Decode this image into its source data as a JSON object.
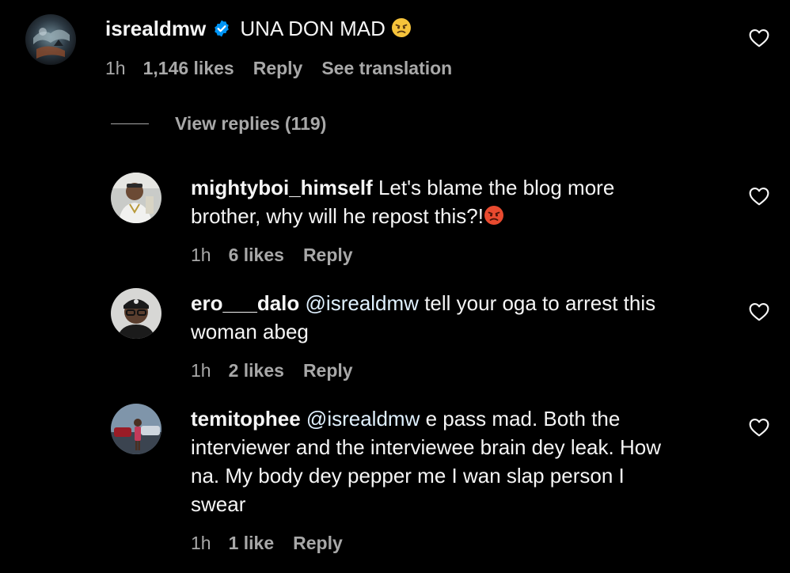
{
  "colors": {
    "background": "#000000",
    "text_primary": "#f5f5f5",
    "text_secondary": "#a8a8a8",
    "verified_badge": "#0095f6"
  },
  "main_comment": {
    "username": "isrealdmw",
    "verified": true,
    "text": "UNA DON MAD",
    "emoji": "angry-face",
    "time": "1h",
    "likes": "1,146 likes",
    "reply_label": "Reply",
    "translation_label": "See translation",
    "view_replies_label": "View replies (119)"
  },
  "replies": [
    {
      "username": "mightyboi_himself",
      "text_line1": "Let's blame the blog more",
      "text_line2": "brother, why will he repost this?!",
      "emoji": "pouting-face",
      "time": "1h",
      "likes": "6 likes",
      "reply_label": "Reply"
    },
    {
      "username": "ero___dalo",
      "mention": "@isrealdmw",
      "text_line1": "tell your oga to arrest this",
      "text_line2": "woman abeg",
      "time": "1h",
      "likes": "2 likes",
      "reply_label": "Reply"
    },
    {
      "username": "temitophee",
      "mention": "@isrealdmw",
      "text_line1": "e pass mad. Both the",
      "text_line2": "interviewer and the interviewee brain dey leak. How",
      "text_line3": "na. My body dey pepper me I wan slap person I",
      "text_line4": "swear",
      "time": "1h",
      "likes": "1 like",
      "reply_label": "Reply"
    }
  ]
}
